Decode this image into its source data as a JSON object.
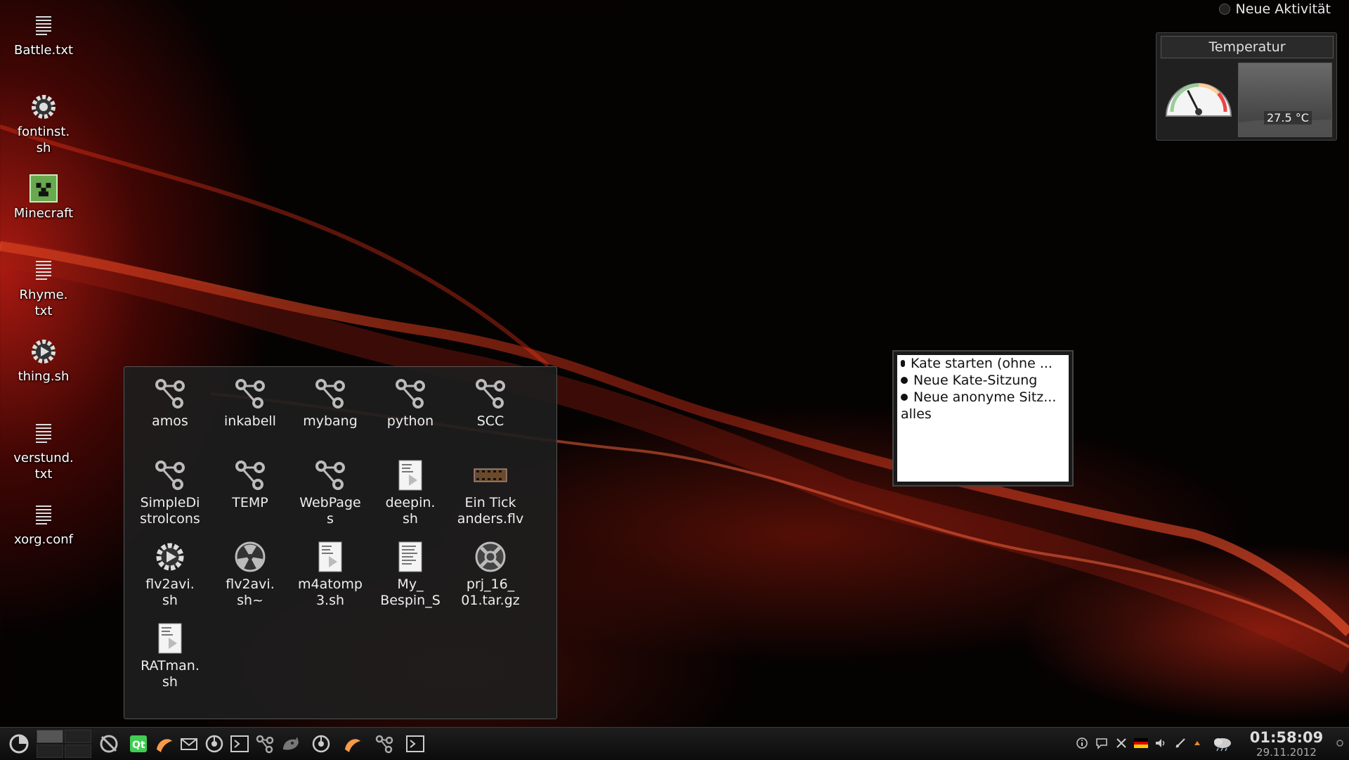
{
  "activity_button": {
    "label": "Neue Aktivität"
  },
  "desktop_icons": [
    {
      "label": "Battle.txt",
      "icon": "text-file-icon"
    },
    {
      "label": "fontinst.\nsh",
      "icon": "gear-script-icon"
    },
    {
      "label": "Minecraft",
      "icon": "minecraft-icon"
    },
    {
      "label": "Rhyme.\ntxt",
      "icon": "text-file-icon"
    },
    {
      "label": "thing.sh",
      "icon": "gear-script-icon"
    },
    {
      "label": "verstund.\ntxt",
      "icon": "text-file-icon"
    },
    {
      "label": "xorg.conf",
      "icon": "text-file-icon"
    }
  ],
  "temperature_widget": {
    "title": "Temperatur",
    "value": "27.5 °C",
    "gauge_fraction": 0.35
  },
  "folder_view": {
    "items": [
      {
        "label": "amos",
        "icon": "folder-network-icon"
      },
      {
        "label": "inkabell",
        "icon": "folder-network-icon"
      },
      {
        "label": "mybang",
        "icon": "folder-network-icon"
      },
      {
        "label": "python",
        "icon": "folder-network-icon"
      },
      {
        "label": "SCC",
        "icon": "folder-network-icon"
      },
      {
        "label": "SimpleDi\nstrolcons",
        "icon": "folder-network-icon"
      },
      {
        "label": "TEMP",
        "icon": "folder-network-icon"
      },
      {
        "label": "WebPage\ns",
        "icon": "folder-network-icon"
      },
      {
        "label": "deepin.\nsh",
        "icon": "script-document-icon"
      },
      {
        "label": "Ein Tick\nanders.flv",
        "icon": "video-file-icon"
      },
      {
        "label": "flv2avi.\nsh",
        "icon": "gear-script-icon"
      },
      {
        "label": "flv2avi.\nsh~",
        "icon": "backup-file-icon"
      },
      {
        "label": "m4atomp\n3.sh",
        "icon": "script-document-icon"
      },
      {
        "label": "My_\nBespin_S",
        "icon": "script-document-icon"
      },
      {
        "label": "prj_16_\n01.tar.gz",
        "icon": "archive-icon"
      },
      {
        "label": "RATman.\nsh",
        "icon": "script-document-icon"
      }
    ]
  },
  "popup_menu": {
    "items": [
      {
        "label": "Kate starten (ohne ..."
      },
      {
        "label": "Neue Kate-Sitzung"
      },
      {
        "label": "Neue anonyme Sitz..."
      },
      {
        "label": "alles"
      }
    ]
  },
  "taskbar": {
    "launchers": [
      "kde-menu-icon",
      "disk-icon",
      "qt-designer-icon",
      "shell-icon",
      "mail-icon",
      "browser-icon",
      "terminal-icon",
      "network-icon",
      "gimp-icon",
      "browser-icon",
      "shell-icon",
      "network-icon",
      "terminal-icon"
    ],
    "tray": [
      "info-icon",
      "notes-icon",
      "tools-icon",
      "flag-de-icon",
      "volume-icon",
      "network-cable-icon",
      "arrow-up-icon",
      "weather-icon"
    ],
    "clock": {
      "time": "01:58:09",
      "date": "29.11.2012"
    }
  },
  "colors": {
    "accent": "#c0281a",
    "panel_bg": "#1a1a1a"
  }
}
